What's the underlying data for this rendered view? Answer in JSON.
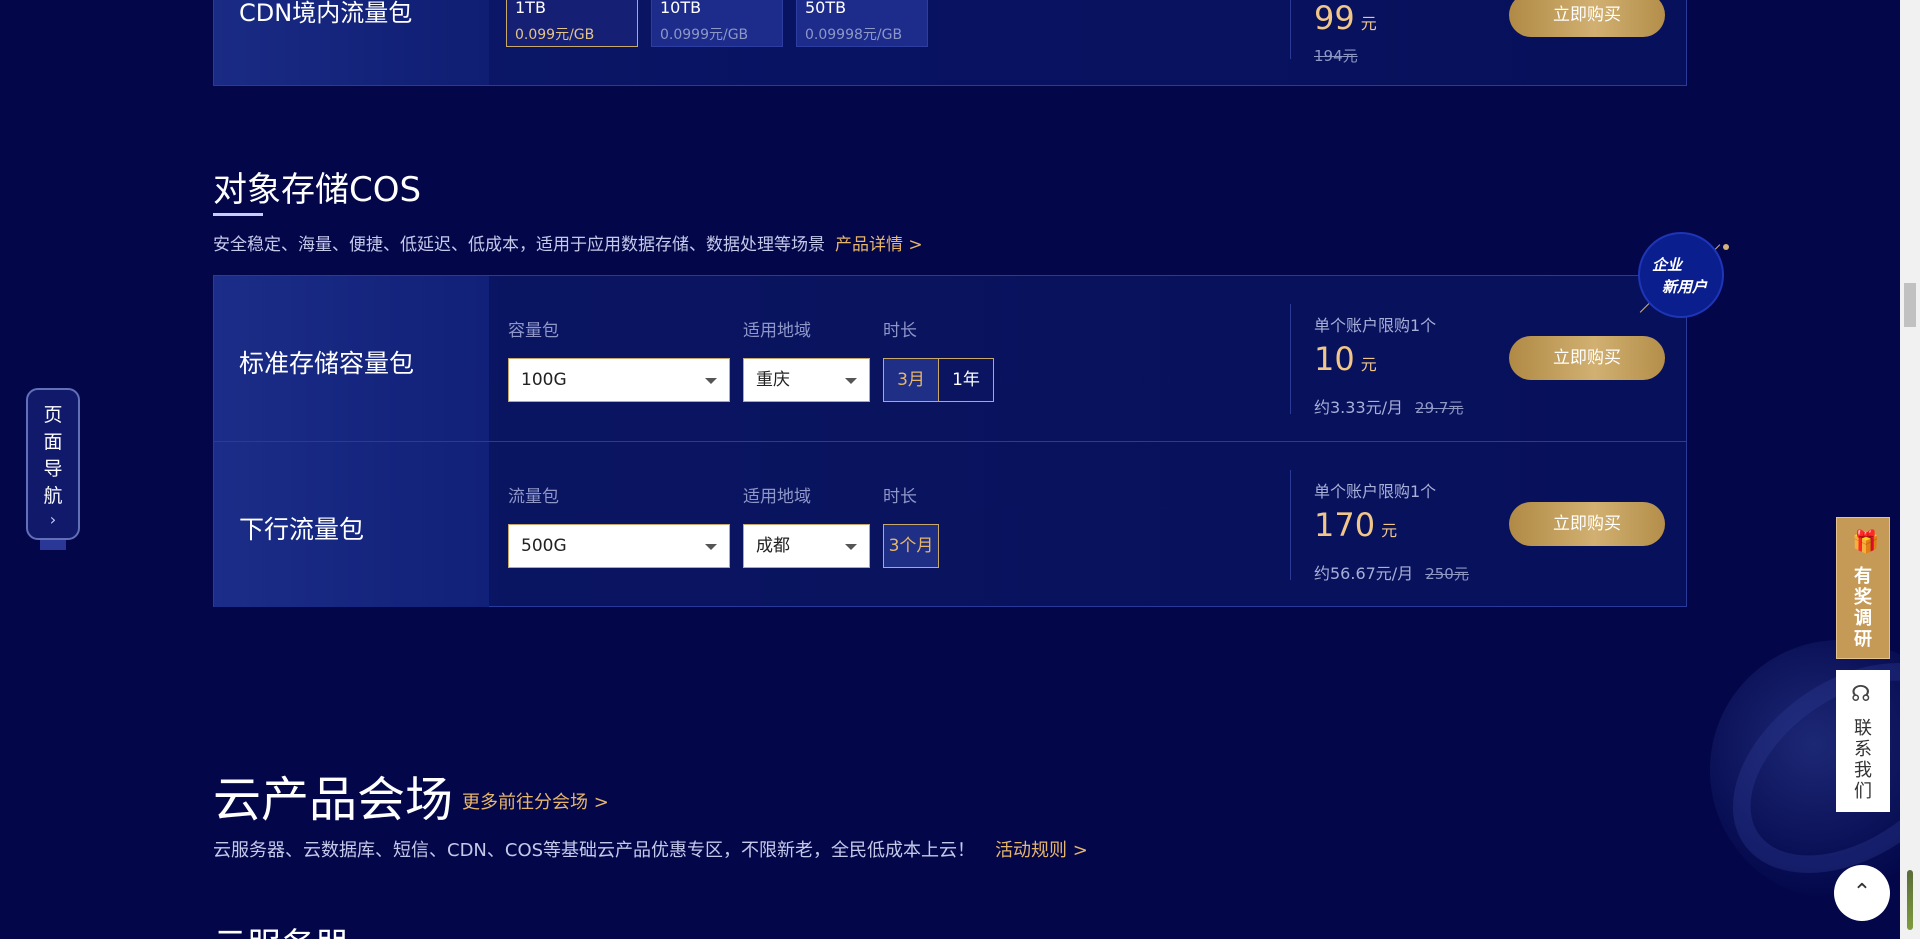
{
  "cdn_card": {
    "name": "CDN境内流量包",
    "chips": [
      {
        "capacity": "1TB",
        "per_gb": "0.099元/GB",
        "selected": true
      },
      {
        "capacity": "10TB",
        "per_gb": "0.0999元/GB",
        "selected": false
      },
      {
        "capacity": "50TB",
        "per_gb": "0.09998元/GB",
        "selected": false
      }
    ],
    "price": "99",
    "unit": "元",
    "original": "194元",
    "buy_label": "立即购买"
  },
  "cos_section": {
    "title": "对象存储COS",
    "desc": "安全稳定、海量、便捷、低延迟、低成本，适用于应用数据存储、数据处理等场景",
    "detail_link": "产品详情 >",
    "badge": {
      "line1": "企业",
      "line2": "新用户"
    },
    "products": [
      {
        "name": "标准存储容量包",
        "field1_label": "容量包",
        "field1_value": "100G",
        "region_label": "适用地域",
        "region_value": "重庆",
        "duration_label": "时长",
        "durations": [
          "3月",
          "1年"
        ],
        "active_duration": "3月",
        "limit": "单个账户限购1个",
        "price": "10",
        "unit": "元",
        "monthly": "约3.33元/月",
        "original": "29.7元",
        "buy_label": "立即购买"
      },
      {
        "name": "下行流量包",
        "field1_label": "流量包",
        "field1_value": "500G",
        "region_label": "适用地域",
        "region_value": "成都",
        "duration_label": "时长",
        "durations": [
          "3个月"
        ],
        "active_duration": "3个月",
        "limit": "单个账户限购1个",
        "price": "170",
        "unit": "元",
        "monthly": "约56.67元/月",
        "original": "250元",
        "buy_label": "立即购买"
      }
    ]
  },
  "cloud_products": {
    "title": "云产品会场",
    "more_link": "更多前往分会场 >",
    "desc": "云服务器、云数据库、短信、CDN、COS等基础云产品优惠专区，不限新老，全民低成本上云！",
    "rules_link": "活动规则 >",
    "next_title": "云服务器"
  },
  "page_nav": {
    "chars": [
      "页",
      "面",
      "导",
      "航"
    ],
    "arrow": "›"
  },
  "widgets": {
    "survey_chars": [
      "有",
      "奖",
      "调",
      "研"
    ],
    "survey_icon": "gift-icon",
    "contact_chars": [
      "联",
      "系",
      "我",
      "们"
    ],
    "contact_icon": "headset-icon",
    "backtop_icon": "chevron-up-icon"
  },
  "colors": {
    "background": "#03074a",
    "accent_gold": "#e6b66a",
    "button_gold": "#c8a461",
    "card_border": "#2a3a9a"
  }
}
